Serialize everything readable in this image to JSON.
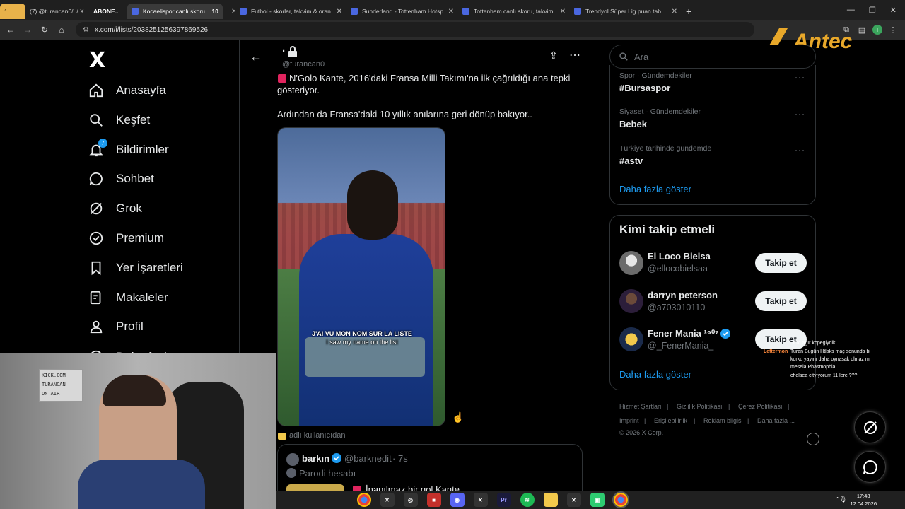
{
  "browser": {
    "tabs": [
      {
        "label": "1",
        "active": false
      },
      {
        "label": "(7) @turancan0/. / X",
        "active": false
      },
      {
        "label": "ABONE..",
        "active": false
      },
      {
        "label": "Kocaelispor canlı skoru, tak",
        "active": true
      },
      {
        "label": "10",
        "active": true
      },
      {
        "label": "Futbol - skorlar, takvim & oran",
        "active": false
      },
      {
        "label": "Sunderland - Tottenham Hotsp",
        "active": false
      },
      {
        "label": "Tottenham canlı skoru, takvim",
        "active": false
      },
      {
        "label": "Trendyol Süper Lig puan tablos",
        "active": false
      }
    ],
    "url": "x.com/i/lists/2038251256397869526"
  },
  "leftnav": {
    "logo": "X",
    "items": [
      {
        "label": "Anasayfa",
        "icon": "home-icon"
      },
      {
        "label": "Keşfet",
        "icon": "search-icon"
      },
      {
        "label": "Bildirimler",
        "icon": "bell-icon",
        "badge": "7"
      },
      {
        "label": "Sohbet",
        "icon": "chat-icon"
      },
      {
        "label": "Grok",
        "icon": "grok-icon"
      },
      {
        "label": "Premium",
        "icon": "premium-icon"
      },
      {
        "label": "Yer İşaretleri",
        "icon": "bookmark-icon"
      },
      {
        "label": "Makaleler",
        "icon": "articles-icon"
      },
      {
        "label": "Profil",
        "icon": "profile-icon"
      },
      {
        "label": "Daha fazla",
        "icon": "more-icon"
      }
    ]
  },
  "tweet": {
    "name": "·",
    "handle": "@turancan0",
    "text1": "N'Golo Kante, 2016'daki Fransa Milli Takımı'na ilk çağrıldığı ana tepki gösteriyor.",
    "text2": "Ardından da Fransa'daki 10 yıllık anılarına geri dönüp bakıyor..",
    "caption_fr": "J'AI VU MON NOM SUR LA LISTE",
    "caption_en": "I saw my name on the list",
    "reposted_by": "adlı kullanıcıdan",
    "quote": {
      "name": "barkın",
      "handle": "@barknedit",
      "time": "7s",
      "label": "Parodi hesabı",
      "text": "İnanılmaz bir gol Kante"
    }
  },
  "right": {
    "search_placeholder": "Ara",
    "trends": [
      {
        "category": "Spor · Gündemdekiler",
        "name": "#Bursaspor"
      },
      {
        "category": "Siyaset · Gündemdekiler",
        "name": "Bebek"
      },
      {
        "category": "Türkiye tarihinde gündemde",
        "name": "#astv"
      }
    ],
    "show_more": "Daha fazla göster",
    "follow_title": "Kimi takip etmeli",
    "follow": [
      {
        "name": "El Loco Bielsa",
        "handle": "@ellocobielsaa",
        "button": "Takip et"
      },
      {
        "name": "darryn peterson",
        "handle": "@a703010110",
        "button": "Takip et"
      },
      {
        "name": "Fener Mania ¹⁹⁰⁷",
        "handle": "@_FenerMania_",
        "button": "Takip et"
      }
    ],
    "follow_more": "Daha fazla göster",
    "footer": [
      "Hizmet Şartları",
      "Gizlilik Politikası",
      "Çerez Politikası",
      "Imprint",
      "Erişilebilirlik",
      "Reklam bilgisi",
      "Daha fazla ...",
      "© 2026 X Corp."
    ]
  },
  "chat": [
    {
      "user": "Leftermon",
      "msg": "Turan Bugün Htlaks maç sonunda bi korku yayını daha oynasak olmaz mı mesela Phasmophia"
    },
    {
      "user": "",
      "msg": "lcfc agır kopegiydik"
    },
    {
      "user": "",
      "msg": "chelsea city yorum 11 lere ???"
    }
  ],
  "webcam_sign": [
    "KICK.COM",
    "TURANCAN",
    "ON AIR"
  ],
  "overlay_logo": "Antec",
  "taskbar": {
    "time": "17:43",
    "date": "12.04.2026"
  }
}
